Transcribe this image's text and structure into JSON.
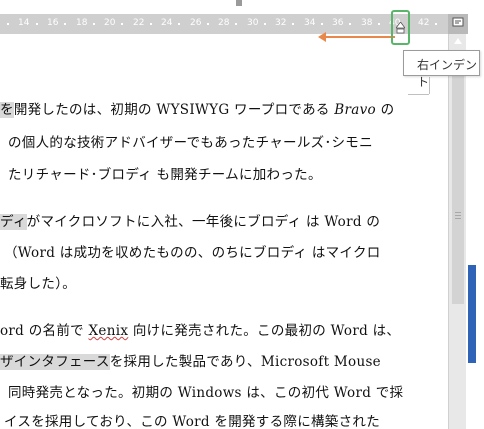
{
  "ruler": {
    "numbers": [
      "14",
      "16",
      "18",
      "20",
      "22",
      "24",
      "26",
      "28",
      "30",
      "32",
      "34",
      "36",
      "38",
      "40",
      "42"
    ]
  },
  "tooltip": {
    "label": "右インデント"
  },
  "colors": {
    "arrow": "#e9884a",
    "highlight_box": "#59b56a",
    "selection": "#d9d9d9",
    "scroll_accent": "#2f63b8"
  },
  "document": {
    "lines": [
      {
        "pre_hl": "を",
        "text": "開発したのは、初期の WYSIWYG ワープロである ",
        "italic": "Bravo",
        "post": " の"
      },
      {
        "text": "の個人的な技術アドバイザーでもあったチャールズ･シモニ"
      },
      {
        "text": "たリチャード･ブロディ も開発チームに加わった。"
      },
      {
        "pre_hl": "ディ",
        "text": "がマイクロソフトに入社、一年後にブロディ は Word の"
      },
      {
        "text": "（Word は成功を収めたものの、のちにブロディ はマイクロ"
      },
      {
        "text": "転身した）。"
      },
      {
        "text": "ord の名前で ",
        "squiggle": "Xenix",
        "post": " 向けに発売された。この最初の Word は、"
      },
      {
        "hl_text": "ザインタフェース",
        "text": "を採用した製品であり、Microsoft Mouse"
      },
      {
        "text": "同時発売となった。初期の Windows は、この初代 Word で採"
      },
      {
        "text": "イスを採用しており、この Word を開発する際に構築された"
      }
    ]
  }
}
